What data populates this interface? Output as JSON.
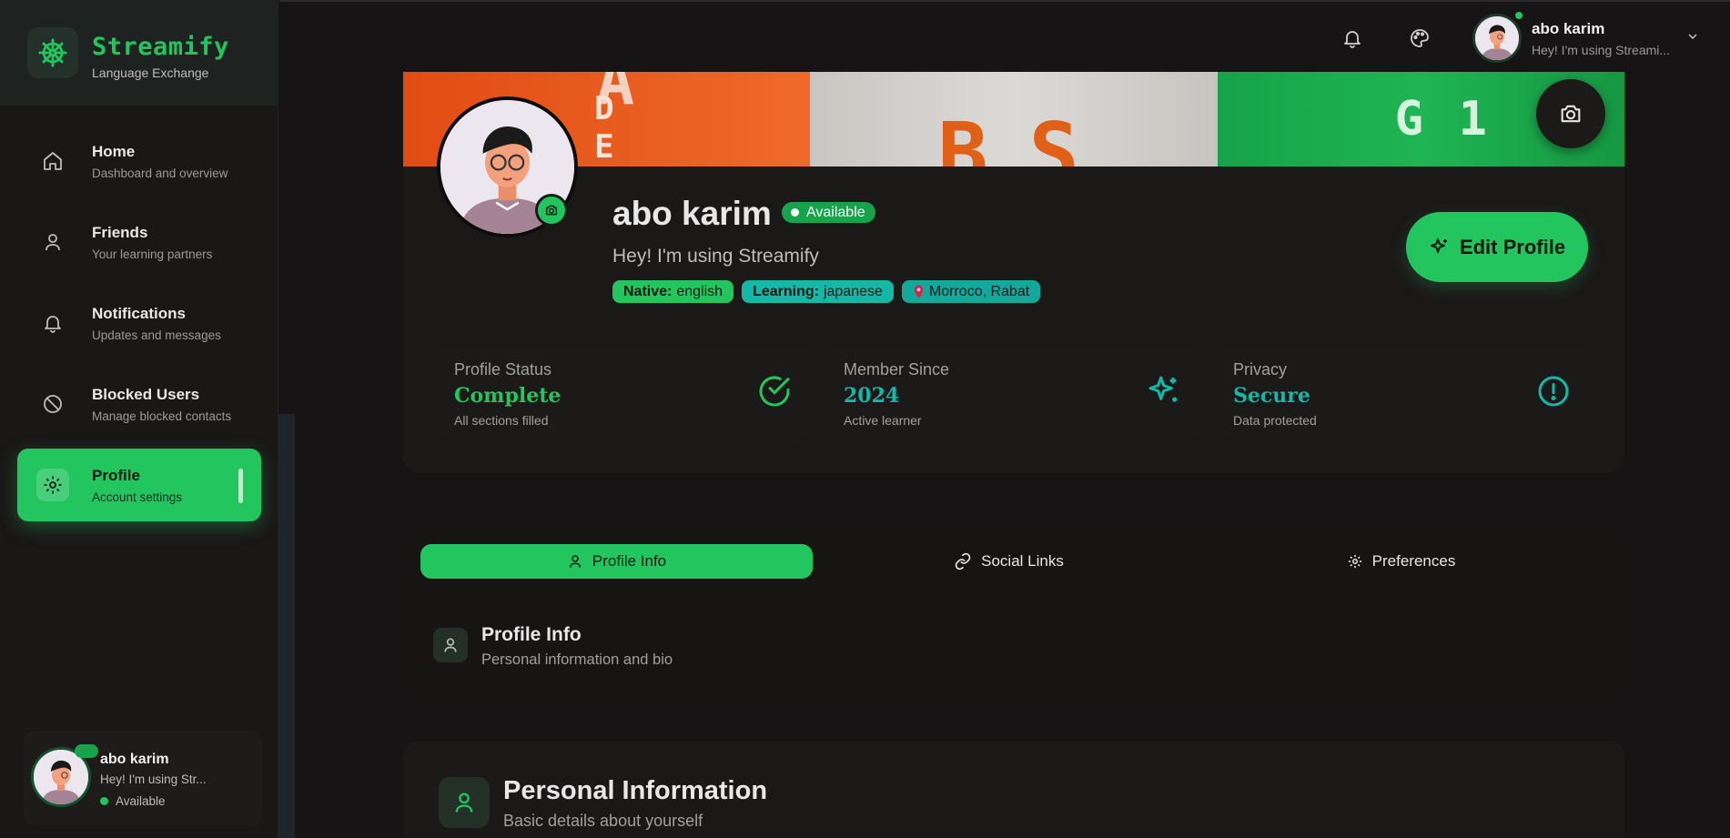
{
  "brand": {
    "name": "Streamify",
    "subtitle": "Language Exchange",
    "icon": "ship-wheel-icon"
  },
  "sidebar": {
    "items": [
      {
        "label": "Home",
        "sub": "Dashboard and overview",
        "icon": "home-icon"
      },
      {
        "label": "Friends",
        "sub": "Your learning partners",
        "icon": "user-icon"
      },
      {
        "label": "Notifications",
        "sub": "Updates and messages",
        "icon": "bell-icon"
      },
      {
        "label": "Blocked Users",
        "sub": "Manage blocked contacts",
        "icon": "ban-icon"
      },
      {
        "label": "Profile",
        "sub": "Account settings",
        "icon": "gear-icon",
        "active": true
      }
    ],
    "user": {
      "name": "abo karim",
      "status": "Hey! I'm using Str...",
      "availability": "Available"
    }
  },
  "topbar": {
    "icons": [
      "bell-icon",
      "palette-icon"
    ],
    "user_name": "abo karim",
    "user_status": "Hey! I'm using Streami..."
  },
  "profile": {
    "name": "abo karim",
    "availability": "Available",
    "status": "Hey! I'm using Streamify",
    "tags": {
      "native_label": "Native:",
      "native_value": "english",
      "learning_label": "Learning:",
      "learning_value": "japanese",
      "location": "Morroco, Rabat"
    },
    "edit_button": "Edit Profile",
    "stats": [
      {
        "label": "Profile Status",
        "value": "Complete",
        "sub": "All sections filled",
        "color": "#22c55e",
        "icon": "check-circle-icon"
      },
      {
        "label": "Member Since",
        "value": "2024",
        "sub": "Active learner",
        "color": "#14b8a6",
        "icon": "sparkles-icon"
      },
      {
        "label": "Privacy",
        "value": "Secure",
        "sub": "Data protected",
        "color": "#14b8a6",
        "icon": "alert-circle-icon"
      }
    ],
    "cover_letters": {
      "orange": [
        "A",
        "D",
        "E"
      ],
      "grey": [
        "B",
        "S"
      ],
      "green": [
        "G",
        "1"
      ]
    }
  },
  "tabs": [
    {
      "label": "Profile Info",
      "icon": "user-icon",
      "active": true
    },
    {
      "label": "Social Links",
      "icon": "link-icon"
    },
    {
      "label": "Preferences",
      "icon": "gear-icon"
    }
  ],
  "profile_info": {
    "title": "Profile Info",
    "sub": "Personal information and bio"
  },
  "personal_information": {
    "title": "Personal Information",
    "sub": "Basic details about yourself"
  },
  "colors": {
    "accent": "#22c55e",
    "teal": "#14b8a6",
    "background": "#161414"
  }
}
